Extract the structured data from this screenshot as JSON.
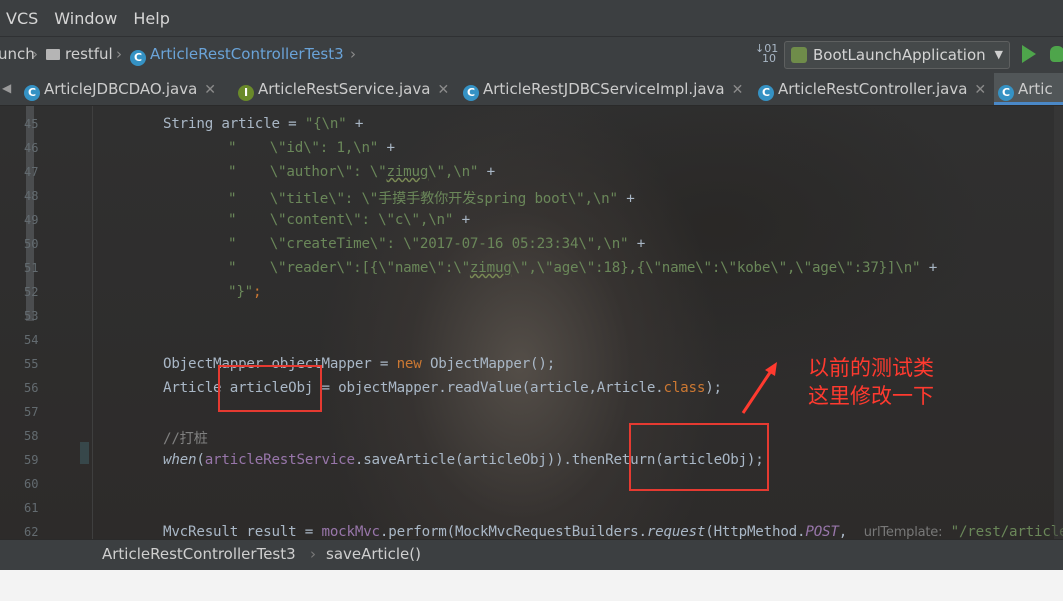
{
  "menu": [
    "VCS",
    "Window",
    "Help"
  ],
  "nav": {
    "crumbs": [
      "unch",
      "restful",
      "ArticleRestControllerTest3"
    ],
    "run_config": "BootLaunchApplication"
  },
  "tabs": [
    {
      "label": "ArticleJDBCDAO.java",
      "icon": "C"
    },
    {
      "label": "ArticleRestService.java",
      "icon": "I"
    },
    {
      "label": "ArticleRestJDBCServiceImpl.java",
      "icon": "C"
    },
    {
      "label": "ArticleRestController.java",
      "icon": "C"
    },
    {
      "label": "Artic",
      "icon": "C"
    }
  ],
  "line_numbers": [
    "45",
    "46",
    "47",
    "48",
    "49",
    "50",
    "51",
    "52",
    "53",
    "54",
    "55",
    "56",
    "57",
    "58",
    "59",
    "60",
    "61",
    "62"
  ],
  "code": {
    "l45": {
      "a": "String article = ",
      "s": "\"{\\n\" ",
      "b": "+"
    },
    "l46": {
      "s1": "\"    \\\"id\\\": 1,\\n\" ",
      "b": "+"
    },
    "l47": {
      "s1": "\"    \\\"author\\\": \\\"",
      "w": "zimug",
      "s2": "\\\",\\n\" ",
      "b": "+"
    },
    "l48": {
      "s1": "\"    \\\"title\\\": \\\"手摸手教你开发spring boot\\\",\\n\" ",
      "b": "+"
    },
    "l49": {
      "s1": "\"    \\\"content\\\": \\\"c\\\",\\n\" ",
      "b": "+"
    },
    "l50": {
      "s1": "\"    \\\"createTime\\\": \\\"2017-07-16 05:23:34\\\",\\n\" ",
      "b": "+"
    },
    "l51": {
      "s1": "\"    \\\"reader\\\":[{\\\"name\\\":\\\"",
      "w": "zimug",
      "s2": "\\\",\\\"age\\\":18},{\\\"name\\\":\\\"kobe\\\",\\\"age\\\":37}]\\n\" ",
      "b": "+"
    },
    "l52": {
      "s1": "\"}\"",
      "b": ";"
    },
    "l55": {
      "a": "ObjectMapper objectMapper = ",
      "kw": "new",
      "b": " ObjectMapper();"
    },
    "l56": {
      "a": "Article articleObj = objectMapper.readValue(article,Article.",
      "kw": "class",
      "b": ");"
    },
    "l58": {
      "c": "//打桩"
    },
    "l59": {
      "i": "when",
      "a": "(",
      "f": "articleRestService",
      "b": ".saveArticle(articleObj)).thenReturn(articleObj);"
    },
    "l62": {
      "a": "MvcResult result = ",
      "f": "mockMvc",
      "b": ".perform(MockMvcRequestBuilders.",
      "i": "request",
      "c": "(HttpMethod.",
      "fi": "POST",
      "d": ",",
      "hint": "urlTemplate:",
      "s": "\"/rest/article\"",
      "e": ")"
    }
  },
  "annotation": {
    "line1": "以前的测试类",
    "line2": "这里修改一下"
  },
  "bottom": {
    "class": "ArticleRestControllerTest3",
    "method": "saveArticle()"
  }
}
